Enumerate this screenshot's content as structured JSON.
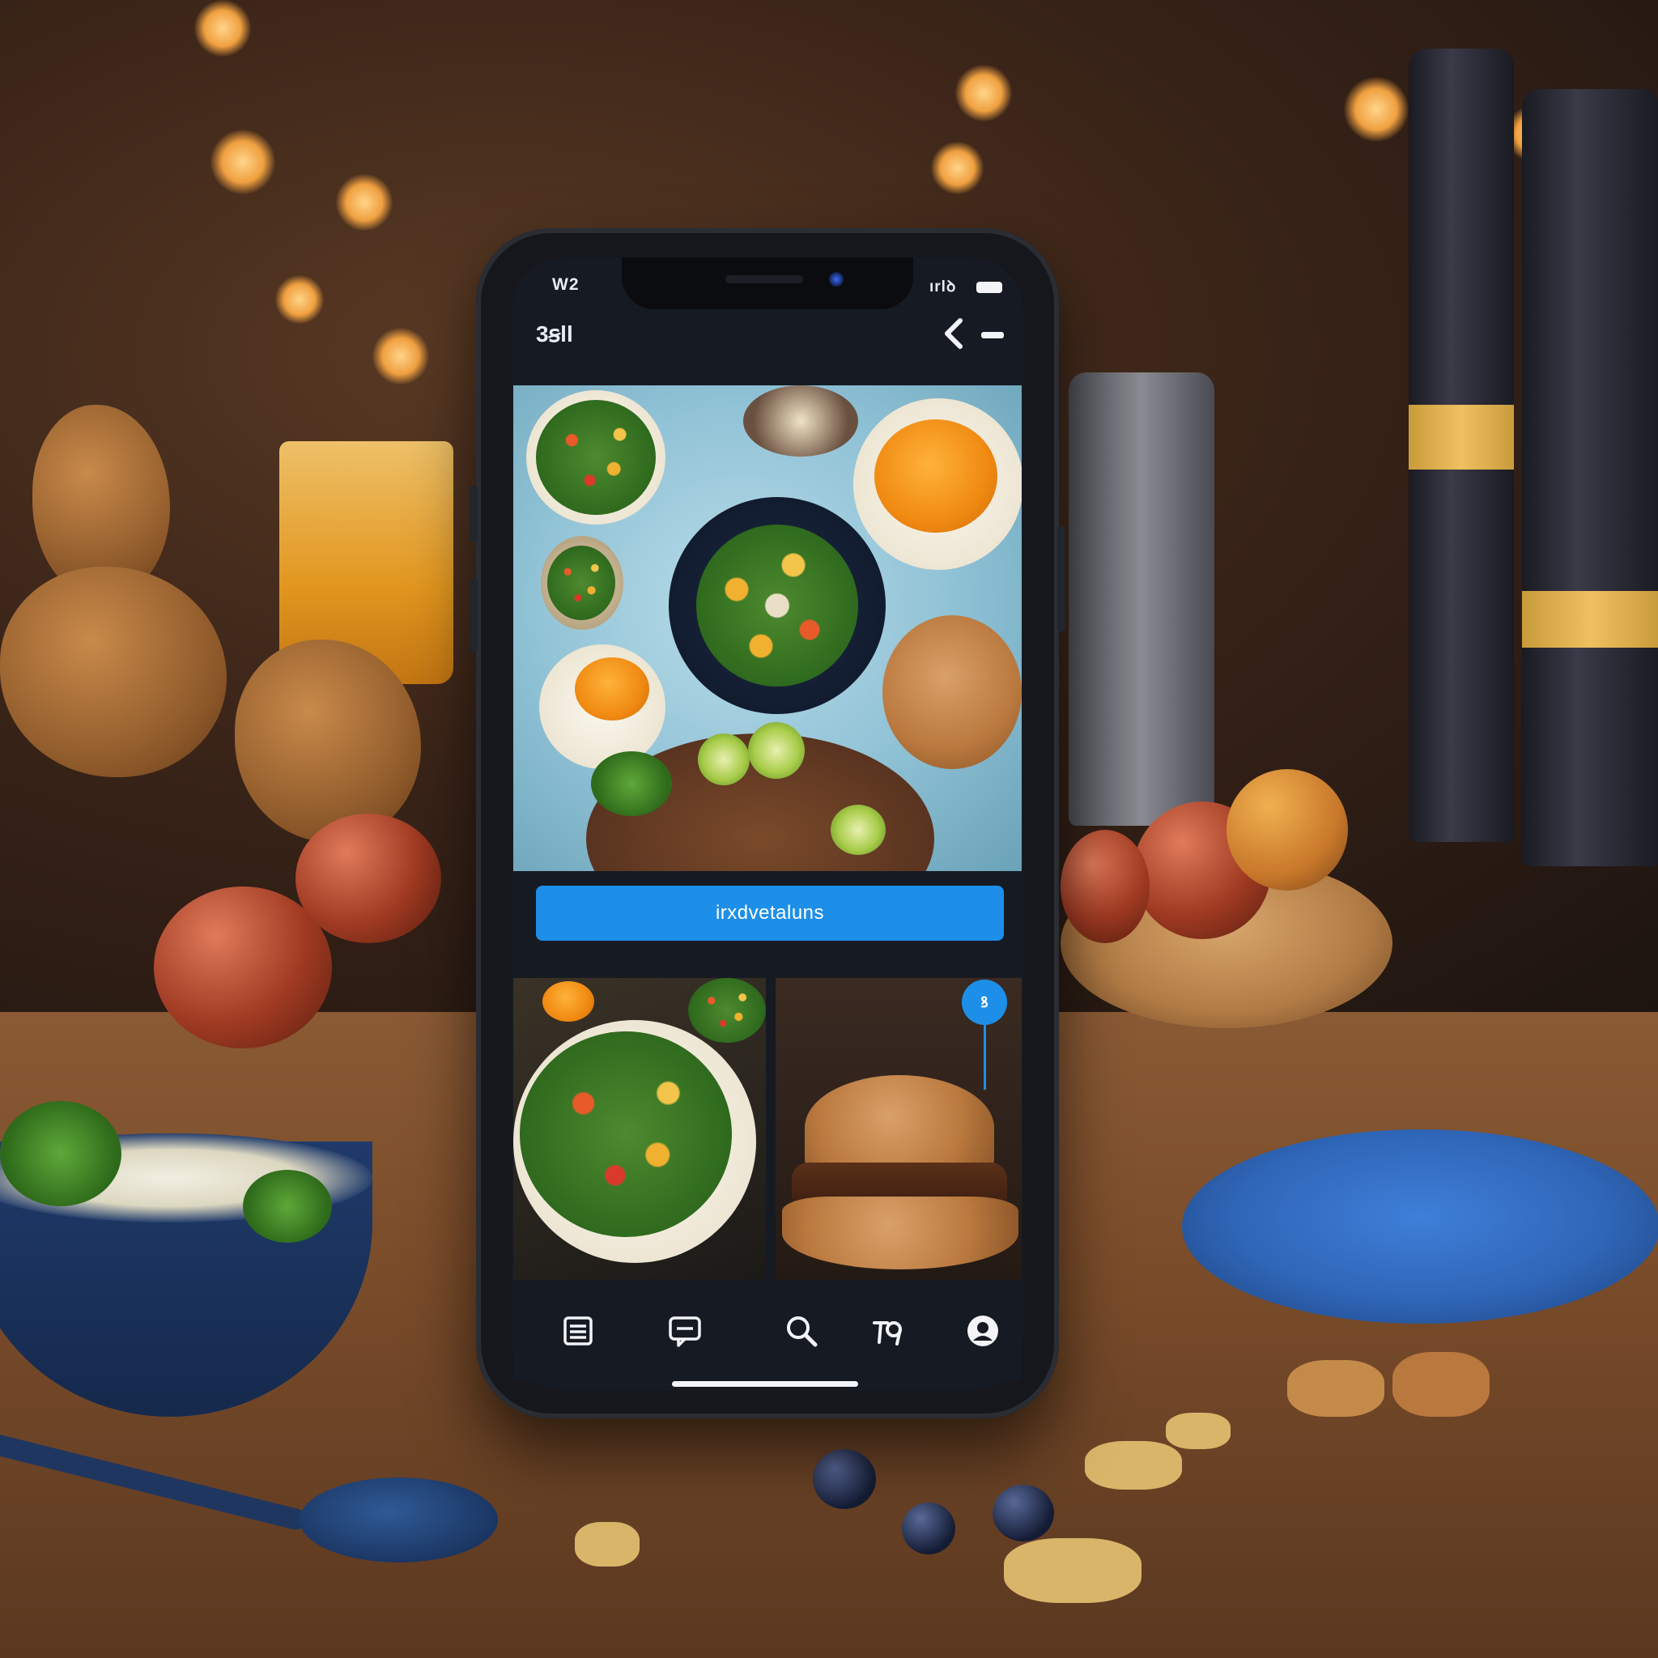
{
  "status_bar": {
    "left": "W2",
    "right": "ırlꝺ"
  },
  "header": {
    "count_label": "3ꞩll"
  },
  "cta": {
    "label": "irxdvetaluns"
  },
  "badge": {
    "label": "ꝸ"
  },
  "colors": {
    "accent": "#1d8fe8",
    "screen_bg": "#161a22",
    "icon": "#f2f4f8"
  },
  "bottom_nav": {
    "items": [
      "list-icon",
      "chat-icon",
      "search-icon",
      "tag-icon",
      "profile-icon"
    ]
  }
}
